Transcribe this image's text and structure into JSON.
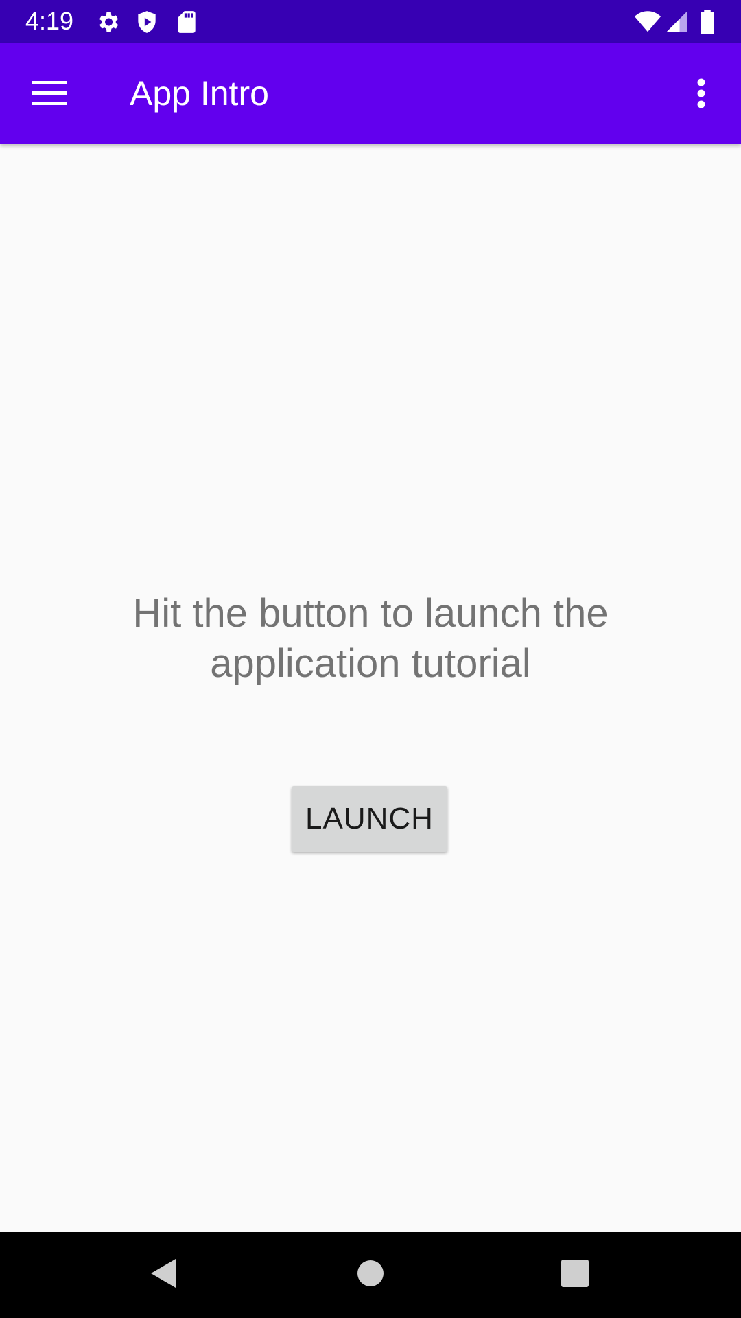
{
  "status_bar": {
    "time": "4:19",
    "icons_left": [
      "settings-icon",
      "shield-play-icon",
      "sd-card-icon"
    ],
    "icons_right": [
      "wifi-icon",
      "signal-icon",
      "battery-icon"
    ]
  },
  "app_bar": {
    "title": "App Intro",
    "menu_icon": "hamburger-menu-icon",
    "overflow_icon": "more-vert-icon",
    "color": "#6200ee"
  },
  "main": {
    "message": "Hit the button to launch the application tutorial",
    "launch_label": "LAUNCH"
  },
  "nav_bar": {
    "buttons": [
      "back-icon",
      "home-icon",
      "recents-icon"
    ]
  },
  "colors": {
    "status_bar": "#3700b3",
    "accent": "#6200ee",
    "background": "#fafafa"
  }
}
